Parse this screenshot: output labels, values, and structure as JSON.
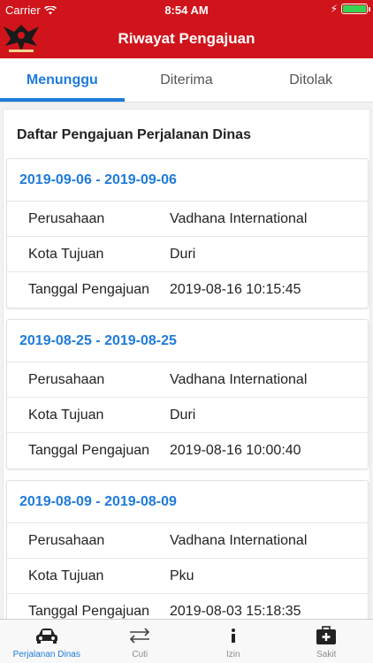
{
  "status_bar": {
    "carrier": "Carrier",
    "time": "8:54 AM"
  },
  "header": {
    "title": "Riwayat Pengajuan"
  },
  "tabs": [
    {
      "label": "Menunggu",
      "active": true
    },
    {
      "label": "Diterima",
      "active": false
    },
    {
      "label": "Ditolak",
      "active": false
    }
  ],
  "list": {
    "section_title": "Daftar Pengajuan Perjalanan Dinas",
    "labels": {
      "company": "Perusahaan",
      "city": "Kota Tujuan",
      "date": "Tanggal Pengajuan"
    },
    "items": [
      {
        "range": "2019-09-06 - 2019-09-06",
        "company": "Vadhana International",
        "city": "Duri",
        "submitted": "2019-08-16 10:15:45"
      },
      {
        "range": "2019-08-25 - 2019-08-25",
        "company": "Vadhana International",
        "city": "Duri",
        "submitted": "2019-08-16 10:00:40"
      },
      {
        "range": "2019-08-09 - 2019-08-09",
        "company": "Vadhana International",
        "city": "Pku",
        "submitted": "2019-08-03 15:18:35"
      }
    ]
  },
  "tabbar": [
    {
      "label": "Perjalanan Dinas",
      "icon": "car-icon",
      "active": true
    },
    {
      "label": "Cuti",
      "icon": "swap-arrows-icon",
      "active": false
    },
    {
      "label": "Izin",
      "icon": "info-icon",
      "active": false
    },
    {
      "label": "Sakit",
      "icon": "medical-kit-icon",
      "active": false
    }
  ],
  "colors": {
    "primary_red": "#d0141b",
    "accent_blue": "#1e7bd9"
  }
}
